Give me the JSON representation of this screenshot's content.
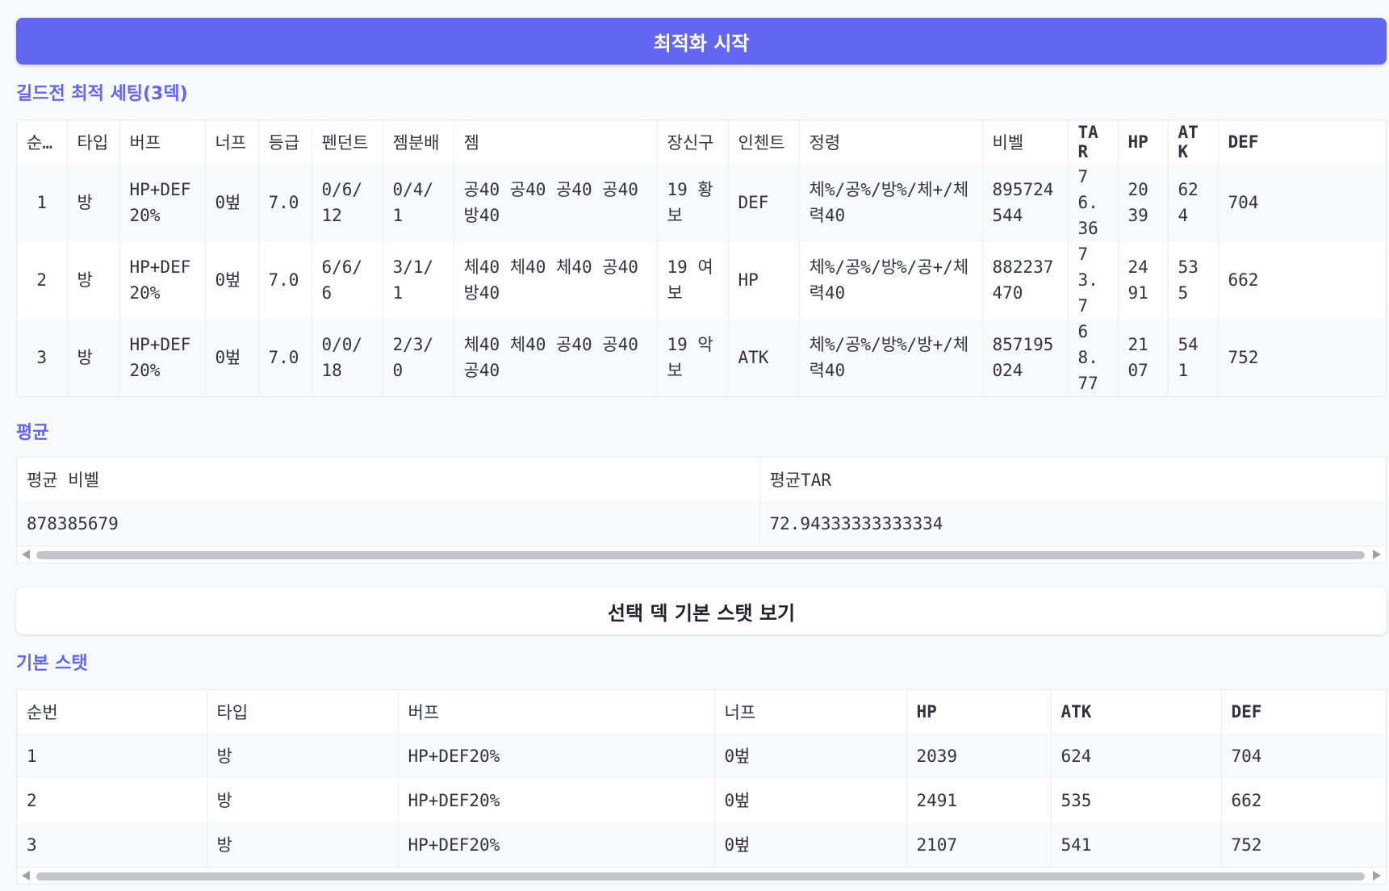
{
  "optimize_button": "최적화 시작",
  "guild_section": {
    "title": "길드전 최적 세팅(3덱)",
    "headers": [
      "순…",
      "타입",
      "버프",
      "너프",
      "등급",
      "펜던트",
      "젬분배",
      "젬",
      "장신구",
      "인첸트",
      "정령",
      "비벨",
      "TAR",
      "HP",
      "ATK",
      "DEF"
    ],
    "rows": [
      [
        "1",
        "방",
        "HP+DEF20%",
        "0벞",
        "7.0",
        "0/6/12",
        "0/4/1",
        "공40 공40 공40 공40 방40",
        "19 황보",
        "DEF",
        "체%/공%/방%/체+/체력40",
        "895724544",
        "76.36",
        "2039",
        "624",
        "704"
      ],
      [
        "2",
        "방",
        "HP+DEF20%",
        "0벞",
        "7.0",
        "6/6/6",
        "3/1/1",
        "체40 체40 체40 공40 방40",
        "19 여보",
        "HP",
        "체%/공%/방%/공+/체력40",
        "882237470",
        "73.7",
        "2491",
        "535",
        "662"
      ],
      [
        "3",
        "방",
        "HP+DEF20%",
        "0벞",
        "7.0",
        "0/0/18",
        "2/3/0",
        "체40 체40 공40 공40 공40",
        "19 악보",
        "ATK",
        "체%/공%/방%/방+/체력40",
        "857195024",
        "68.77",
        "2107",
        "541",
        "752"
      ]
    ]
  },
  "average_section": {
    "title": "평균",
    "headers": [
      "평균 비벨",
      "평균TAR"
    ],
    "values": [
      "878385679",
      "72.94333333333334"
    ]
  },
  "view_stats_button": "선택 덱 기본 스탯 보기",
  "base_section": {
    "title": "기본 스탯",
    "headers": [
      "순번",
      "타입",
      "버프",
      "너프",
      "HP",
      "ATK",
      "DEF"
    ],
    "rows": [
      [
        "1",
        "방",
        "HP+DEF20%",
        "0벞",
        "2039",
        "624",
        "704"
      ],
      [
        "2",
        "방",
        "HP+DEF20%",
        "0벞",
        "2491",
        "535",
        "662"
      ],
      [
        "3",
        "방",
        "HP+DEF20%",
        "0벞",
        "2107",
        "541",
        "752"
      ]
    ]
  },
  "colors": {
    "accent": "#6366f1",
    "background": "#f8f9fb"
  }
}
